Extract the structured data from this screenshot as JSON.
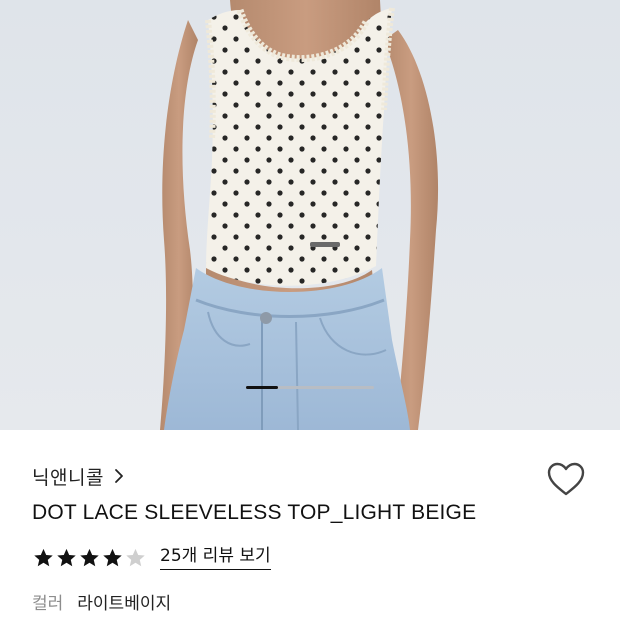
{
  "product": {
    "brand": "닉앤니콜",
    "brand_chevron_icon": "chevron-right-icon",
    "title": "DOT LACE SLEEVELESS TOP_LIGHT BEIGE",
    "wishlist_icon": "heart-outline-icon",
    "rating": 4,
    "rating_max": 5,
    "review_link": "25개 리뷰 보기",
    "option_label": "컬러",
    "option_value": "라이트베이지"
  },
  "gallery": {
    "image_alt_icon": "product-photo",
    "current_slide_fraction": 0.25
  },
  "colors": {
    "star_filled": "#111111",
    "star_empty": "#cfcfcf",
    "text_muted": "#8d8d8d",
    "top_fabric": "#f4f1e9",
    "dot": "#1c1c1c",
    "denim": "#a7c1dc"
  }
}
